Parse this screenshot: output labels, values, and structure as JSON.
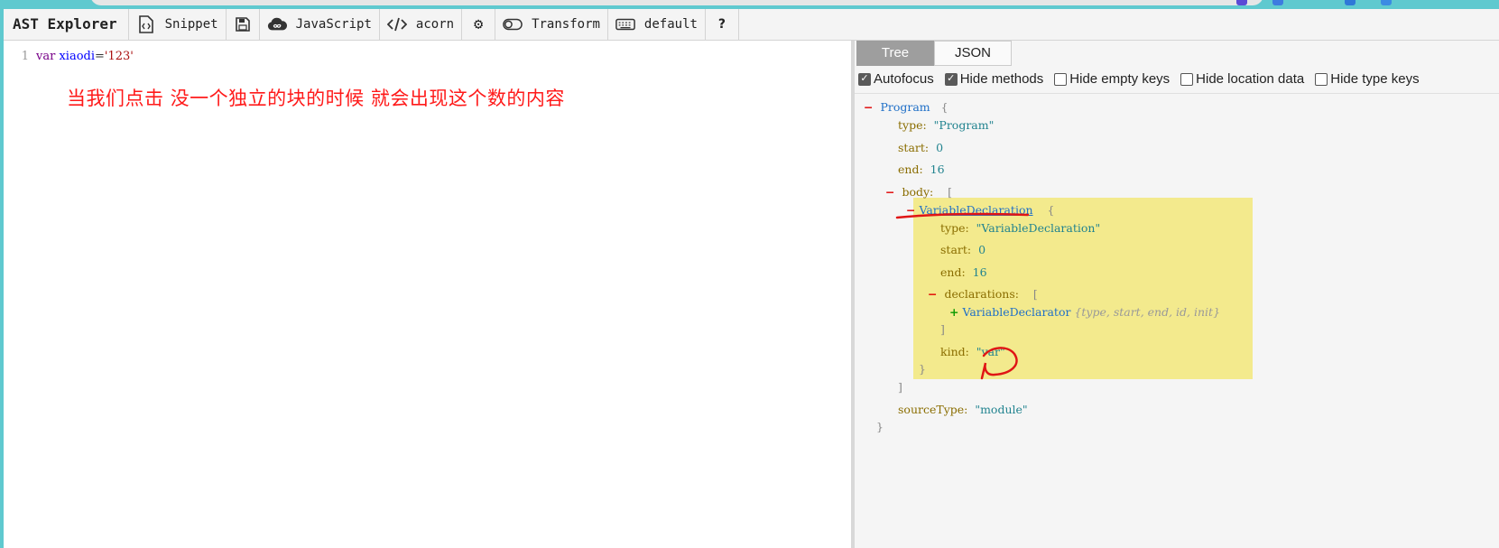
{
  "toolbar": {
    "brand": "AST Explorer",
    "snippet": "Snippet",
    "language": "JavaScript",
    "parser": "acorn",
    "transform": "Transform",
    "keymap": "default"
  },
  "editor": {
    "line_number": "1",
    "code_tokens": {
      "keyword": "var",
      "name": "xiaodi",
      "op": "=",
      "string": "'123'"
    },
    "annotation": "当我们点击  没一个独立的块的时候  就会出现这个数的内容"
  },
  "panel": {
    "tabs": [
      "Tree",
      "JSON"
    ],
    "options": [
      {
        "label": "Autofocus",
        "checked": true
      },
      {
        "label": "Hide methods",
        "checked": true
      },
      {
        "label": "Hide empty keys",
        "checked": false
      },
      {
        "label": "Hide location data",
        "checked": false
      },
      {
        "label": "Hide type keys",
        "checked": false
      }
    ]
  },
  "tree": {
    "root_name": "Program",
    "root_type_key": "type:",
    "root_type_val": "\"Program\"",
    "root_start_key": "start:",
    "root_start_val": "0",
    "root_end_key": "end:",
    "root_end_val": "16",
    "body_key": "body:",
    "decl_name": "VariableDeclaration",
    "decl_type_key": "type:",
    "decl_type_val": "\"VariableDeclaration\"",
    "decl_start_key": "start:",
    "decl_start_val": "0",
    "decl_end_key": "end:",
    "decl_end_val": "16",
    "declarations_key": "declarations:",
    "declarator_name": "VariableDeclarator",
    "declarator_summary": "{type, start, end, id, init}",
    "kind_key": "kind:",
    "kind_val": "\"var\"",
    "source_type_key": "sourceType:",
    "source_type_val": "\"module\""
  },
  "colors": {
    "highlight": "#f3ea8d",
    "annotation_ink": "#ff1a1a",
    "active_tab": "#9e9e9e"
  }
}
